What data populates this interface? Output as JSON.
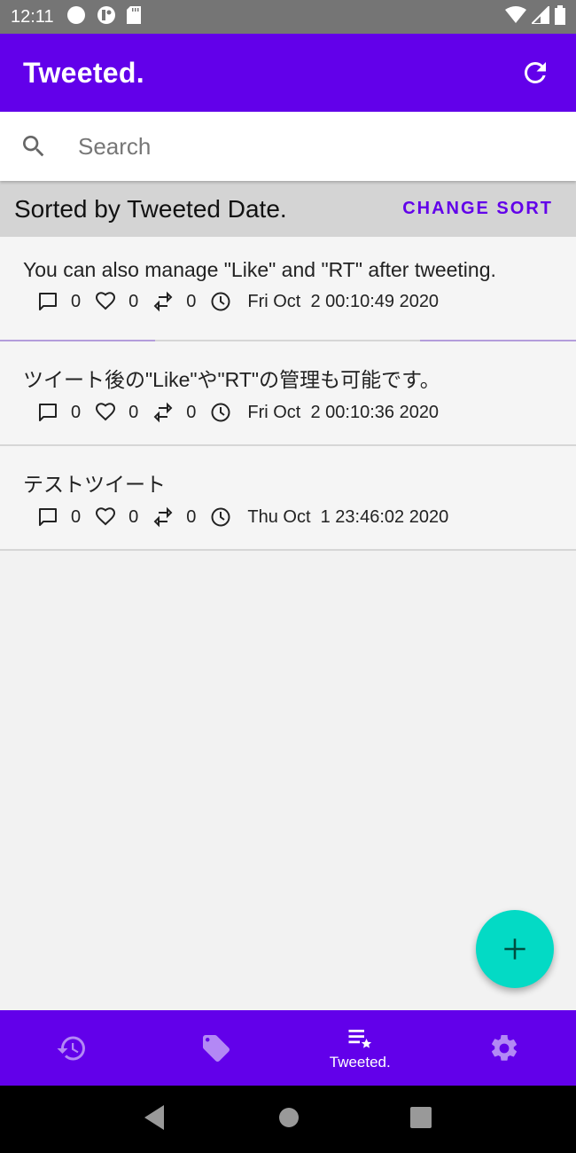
{
  "status_bar": {
    "time": "12:11",
    "left_icons": [
      "circle-notification-icon",
      "app-notification-icon",
      "sd-card-icon"
    ],
    "right_icons": [
      "wifi-icon",
      "signal-icon",
      "battery-icon"
    ]
  },
  "app_bar": {
    "title": "Tweeted.",
    "action_icon": "refresh-icon"
  },
  "search": {
    "placeholder": "Search",
    "value": ""
  },
  "sort": {
    "label": "Sorted by Tweeted Date.",
    "button_label": "CHANGE SORT"
  },
  "tweets": [
    {
      "text": "You can also manage \"Like\" and \"RT\" after tweeting.",
      "replies": "0",
      "likes": "0",
      "retweets": "0",
      "date": "Fri Oct  2 00:10:49 2020"
    },
    {
      "text": "ツイート後の\"Like\"や\"RT\"の管理も可能です。",
      "replies": "0",
      "likes": "0",
      "retweets": "0",
      "date": "Fri Oct  2 00:10:36 2020"
    },
    {
      "text": "テストツイート",
      "replies": "0",
      "likes": "0",
      "retweets": "0",
      "date": "Thu Oct  1 23:46:02 2020"
    }
  ],
  "fab": {
    "icon": "plus-icon"
  },
  "bottom_nav": {
    "items": [
      {
        "icon": "history-icon",
        "label": ""
      },
      {
        "icon": "tag-icon",
        "label": ""
      },
      {
        "icon": "playlist-star-icon",
        "label": "Tweeted.",
        "active": true
      },
      {
        "icon": "settings-icon",
        "label": ""
      }
    ]
  },
  "colors": {
    "primary": "#6200ea",
    "accent": "#03dac5",
    "inactive_nav_icon": "#b388f5"
  }
}
